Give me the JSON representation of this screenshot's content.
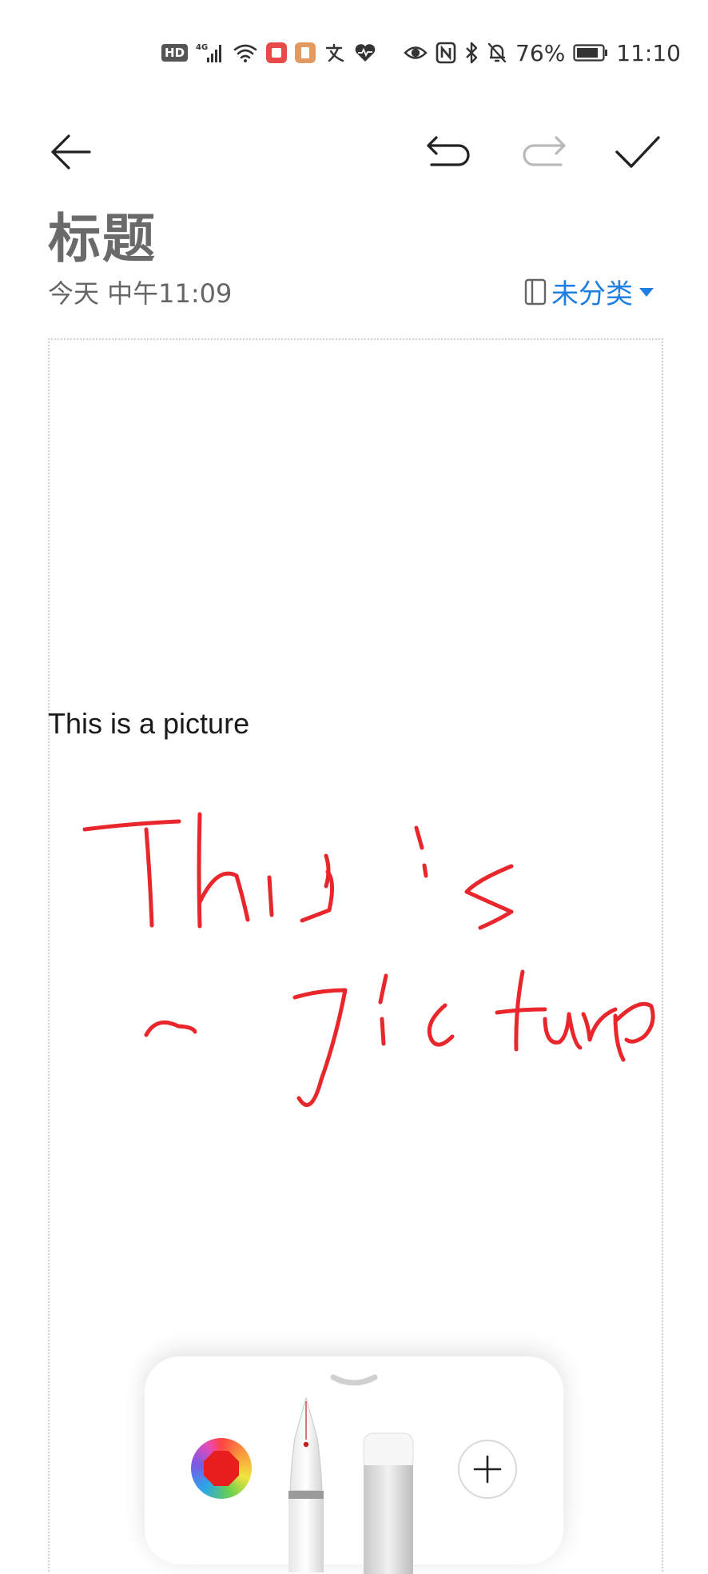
{
  "status_bar": {
    "hd_label": "HD",
    "net_label": "4G",
    "battery_percent": "76%",
    "time": "11:10"
  },
  "toolbar": {
    "back_icon": "arrow-left-icon",
    "undo_icon": "undo-icon",
    "redo_icon": "redo-icon",
    "done_icon": "check-icon",
    "redo_enabled": false
  },
  "note": {
    "title": "标题",
    "datetime": "今天 中午11:09",
    "category": "未分类",
    "typed_text": "This is a picture",
    "ink_color": "#e8262b"
  },
  "tool_panel": {
    "selected_color": "#e81e1e",
    "tools": [
      "color-picker",
      "fountain-pen",
      "marker",
      "add"
    ]
  }
}
